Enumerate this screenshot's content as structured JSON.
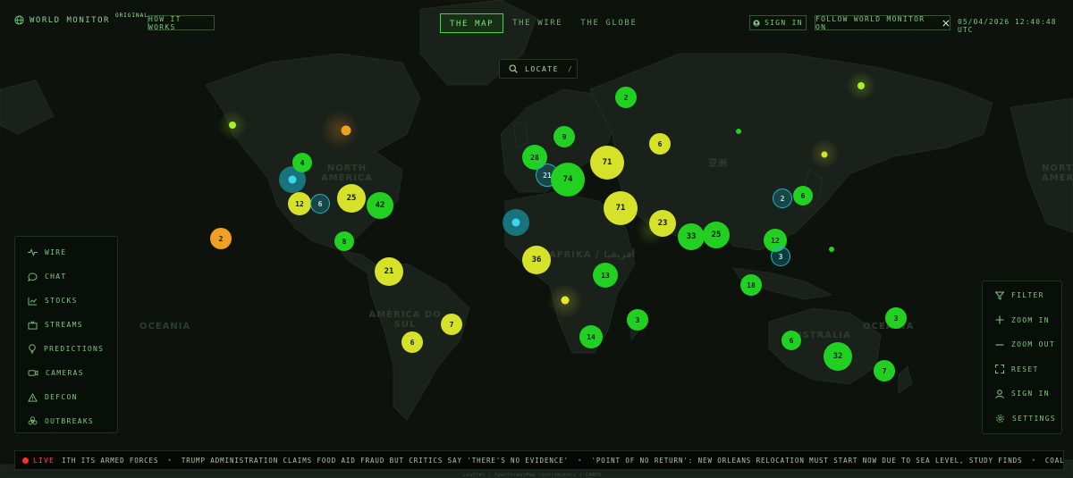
{
  "app": {
    "name": "WORLD MONITOR",
    "badge": "ORIGINAL"
  },
  "header": {
    "how_it_works": "HOW IT WORKS",
    "tabs": [
      {
        "label": "THE MAP",
        "active": true
      },
      {
        "label": "THE WIRE",
        "active": false
      },
      {
        "label": "THE GLOBE",
        "active": false
      }
    ],
    "sign_in": "SIGN IN",
    "follow": "FOLLOW WORLD MONITOR ON",
    "datetime": "05/04/2026 12:40:48 UTC"
  },
  "search": {
    "label": "LOCATE",
    "shortcut": "/"
  },
  "sidebar": {
    "items": [
      {
        "label": "WIRE",
        "icon": "pulse-icon"
      },
      {
        "label": "CHAT",
        "icon": "chat-icon"
      },
      {
        "label": "STOCKS",
        "icon": "chart-icon"
      },
      {
        "label": "STREAMS",
        "icon": "tv-icon"
      },
      {
        "label": "PREDICTIONS",
        "icon": "lightbulb-icon"
      },
      {
        "label": "CAMERAS",
        "icon": "camera-icon"
      },
      {
        "label": "DEFCON",
        "icon": "warning-icon"
      },
      {
        "label": "OUTBREAKS",
        "icon": "biohazard-icon"
      }
    ]
  },
  "tools": {
    "items": [
      {
        "label": "FILTER",
        "icon": "filter-icon"
      },
      {
        "label": "ZOOM IN",
        "icon": "plus-icon"
      },
      {
        "label": "ZOOM OUT",
        "icon": "minus-icon"
      },
      {
        "label": "RESET",
        "icon": "expand-icon"
      },
      {
        "label": "SIGN IN",
        "icon": "user-icon"
      },
      {
        "label": "SETTINGS",
        "icon": "gear-icon"
      }
    ]
  },
  "ticker": {
    "live": "LIVE",
    "items": [
      "ITH ITS ARMED FORCES",
      "TRUMP ADMINISTRATION CLAIMS FOOD AID FRAUD BUT CRITICS SAY 'THERE'S NO EVIDENCE'",
      "'POINT OF NO RETURN': NEW ORLEANS RELOCATION MUST START NOW DUE TO SEA LEVEL, STUDY FINDS",
      "COALITION ACCUSED OF SECRETLY GIVING"
    ],
    "separator": "•"
  },
  "map_labels": [
    {
      "text": "NORTH AMERICA"
    },
    {
      "text": "OCEANIA"
    },
    {
      "text": "AMÉRICA DO SUL"
    },
    {
      "text": "AFRIKA / أفريقيا"
    },
    {
      "text": "亚洲"
    },
    {
      "text": "AUSTRALIA"
    },
    {
      "text": "OCEANIA"
    },
    {
      "text": "NORTH AMERICA"
    }
  ],
  "clusters": [
    {
      "count": "2",
      "color": "#22d022"
    },
    {
      "count": "9",
      "color": "#22d022"
    },
    {
      "count": "6",
      "color": "#d6e12a"
    },
    {
      "count": "28",
      "color": "#22d022"
    },
    {
      "count": "21",
      "color": "#1ab8d0"
    },
    {
      "count": "74",
      "color": "#22d022"
    },
    {
      "count": "71",
      "color": "#d6e12a"
    },
    {
      "count": "4",
      "color": "#22d022"
    },
    {
      "count": "25",
      "color": "#d6e12a"
    },
    {
      "count": "42",
      "color": "#22d022"
    },
    {
      "count": "12",
      "color": "#d6e12a"
    },
    {
      "count": "6",
      "color": "#1ab8d0"
    },
    {
      "count": "71",
      "color": "#d6e12a"
    },
    {
      "count": "23",
      "color": "#d6e12a"
    },
    {
      "count": "33",
      "color": "#22d022"
    },
    {
      "count": "25",
      "color": "#22d022"
    },
    {
      "count": "2",
      "color": "#1ab8d0"
    },
    {
      "count": "6",
      "color": "#22d022"
    },
    {
      "count": "12",
      "color": "#22d022"
    },
    {
      "count": "3",
      "color": "#1ab8d0"
    },
    {
      "count": "2",
      "color": "#f0a020"
    },
    {
      "count": "8",
      "color": "#22d022"
    },
    {
      "count": "21",
      "color": "#d6e12a"
    },
    {
      "count": "36",
      "color": "#d6e12a"
    },
    {
      "count": "13",
      "color": "#22d022"
    },
    {
      "count": "18",
      "color": "#22d022"
    },
    {
      "count": "7",
      "color": "#d6e12a"
    },
    {
      "count": "6",
      "color": "#d6e12a"
    },
    {
      "count": "3",
      "color": "#22d022"
    },
    {
      "count": "14",
      "color": "#22d022"
    },
    {
      "count": "6",
      "color": "#22d022"
    },
    {
      "count": "32",
      "color": "#22d022"
    },
    {
      "count": "7",
      "color": "#22d022"
    },
    {
      "count": "3",
      "color": "#22d022"
    }
  ],
  "colors": {
    "accent": "#3ddc3d",
    "green": "#22d022",
    "yellow": "#d6e12a",
    "cyan": "#1ab8d0",
    "orange": "#f0a020",
    "live": "#ff3030"
  },
  "attribution": "Leaflet | OpenStreetMap contributors | CARTO"
}
